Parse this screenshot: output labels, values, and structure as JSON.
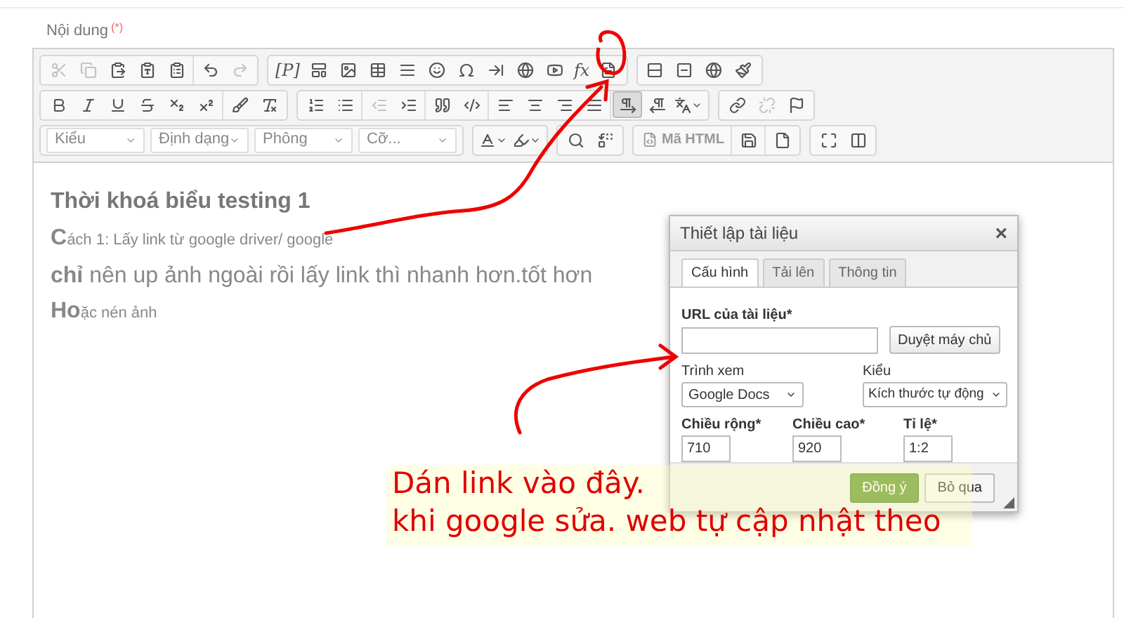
{
  "field": {
    "label": "Nội dung",
    "required_mark": "(*)"
  },
  "toolbar": {
    "rows": [
      {
        "groups": [
          [
            [
              {
                "kind": "icon",
                "disabled": true,
                "on": false
              },
              {
                "kind": "icon",
                "disabled": true,
                "on": false
              },
              {
                "kind": "icon",
                "disabled": false,
                "on": false
              },
              {
                "kind": "icon",
                "disabled": false,
                "on": false
              },
              {
                "kind": "icon",
                "disabled": false,
                "on": false
              }
            ],
            [
              {
                "kind": "icon",
                "disabled": false,
                "on": false
              },
              {
                "kind": "icon",
                "disabled": true,
                "on": false
              }
            ]
          ],
          [
            [
              {
                "kind": "label",
                "label": "[P]",
                "disabled": false,
                "on": false
              },
              {
                "kind": "icon",
                "disabled": false,
                "on": false
              },
              {
                "kind": "icon",
                "disabled": false,
                "on": false
              },
              {
                "kind": "icon",
                "disabled": false,
                "on": false
              },
              {
                "kind": "icon",
                "disabled": false,
                "on": false
              },
              {
                "kind": "icon",
                "disabled": false,
                "on": false
              },
              {
                "kind": "icon",
                "disabled": false,
                "on": false
              },
              {
                "kind": "icon",
                "disabled": false,
                "on": false
              },
              {
                "kind": "icon",
                "disabled": false,
                "on": false
              },
              {
                "kind": "icon",
                "disabled": false,
                "on": false
              },
              {
                "kind": "label",
                "label": "fx",
                "disabled": false,
                "on": false
              },
              {
                "kind": "icon",
                "disabled": false,
                "on": false
              }
            ]
          ],
          [
            [
              {
                "kind": "icon",
                "disabled": false,
                "on": false
              },
              {
                "kind": "icon",
                "disabled": false,
                "on": false
              },
              {
                "kind": "icon",
                "disabled": false,
                "on": false
              },
              {
                "kind": "icon",
                "disabled": false,
                "on": false
              }
            ]
          ]
        ]
      },
      {
        "groups": [
          [
            [
              {
                "kind": "icon",
                "disabled": false,
                "on": false
              },
              {
                "kind": "icon",
                "disabled": false,
                "on": false
              },
              {
                "kind": "icon",
                "disabled": false,
                "on": false
              },
              {
                "kind": "icon",
                "disabled": false,
                "on": false
              },
              {
                "kind": "icon",
                "disabled": false,
                "on": false
              },
              {
                "kind": "icon",
                "disabled": false,
                "on": false
              }
            ],
            [
              {
                "kind": "icon",
                "disabled": false,
                "on": false
              },
              {
                "kind": "icon",
                "disabled": false,
                "on": false
              }
            ]
          ],
          [
            [
              {
                "kind": "icon",
                "disabled": false,
                "on": false
              },
              {
                "kind": "icon",
                "disabled": false,
                "on": false
              }
            ],
            [
              {
                "kind": "icon",
                "disabled": true,
                "on": false
              },
              {
                "kind": "icon",
                "disabled": false,
                "on": false
              }
            ],
            [
              {
                "kind": "icon",
                "disabled": false,
                "on": false
              },
              {
                "kind": "icon",
                "disabled": false,
                "on": false
              }
            ],
            [
              {
                "kind": "icon",
                "disabled": false,
                "on": false
              },
              {
                "kind": "icon",
                "disabled": false,
                "on": false
              },
              {
                "kind": "icon",
                "disabled": false,
                "on": false
              },
              {
                "kind": "icon",
                "disabled": false,
                "on": false
              }
            ],
            [
              {
                "kind": "icon",
                "disabled": false,
                "on": true
              },
              {
                "kind": "icon",
                "disabled": false,
                "on": false
              },
              {
                "kind": "menu",
                "disabled": false,
                "on": false
              }
            ]
          ],
          [
            [
              {
                "kind": "icon",
                "disabled": false,
                "on": false
              },
              {
                "kind": "icon",
                "disabled": true,
                "on": false
              },
              {
                "kind": "icon",
                "disabled": false,
                "on": false
              }
            ]
          ]
        ]
      },
      {
        "groups": [
          [
            [
              {
                "kind": "dropdown",
                "label": "Kiểu"
              },
              {
                "kind": "dropdown",
                "label": "Định dạng"
              },
              {
                "kind": "dropdown",
                "label": "Phông"
              },
              {
                "kind": "dropdown",
                "label": "Cỡ..."
              }
            ]
          ],
          [
            [
              {
                "kind": "menu",
                "disabled": false,
                "on": false
              },
              {
                "kind": "menu",
                "disabled": false,
                "on": false
              }
            ]
          ],
          [
            [
              {
                "kind": "icon",
                "disabled": false,
                "on": false
              },
              {
                "kind": "icon",
                "disabled": false,
                "on": false
              }
            ]
          ],
          [
            [
              {
                "kind": "source",
                "label": "Mã HTML",
                "disabled": false,
                "on": false
              }
            ],
            [
              {
                "kind": "icon",
                "disabled": false,
                "on": false
              }
            ],
            [
              {
                "kind": "icon",
                "disabled": false,
                "on": false
              }
            ]
          ],
          [
            [
              {
                "kind": "icon",
                "disabled": false,
                "on": false
              },
              {
                "kind": "icon",
                "disabled": false,
                "on": false
              }
            ]
          ]
        ]
      }
    ]
  },
  "content": {
    "title": "Thời khoá biểu testing 1",
    "lines": [
      {
        "lead": "C",
        "text": "ách 1: Lấy link từ google driver/ google"
      },
      {
        "text": "**chỉ** nên up ảnh ngoài rồi lấy link thì nhanh hơn.tốt hơn"
      },
      {
        "lead": "Ho",
        "text": "ặc nén ảnh"
      }
    ]
  },
  "dialog": {
    "title": "Thiết lập tài liệu",
    "close": "×",
    "tabs": [
      {
        "label": "Cấu hình",
        "selected": true
      },
      {
        "label": "Tải lên",
        "selected": false
      },
      {
        "label": "Thông tin",
        "selected": false
      }
    ],
    "url": {
      "label": "URL của tài liệu*",
      "browse": "Duyệt máy chủ"
    },
    "viewer": {
      "label": "Trình xem",
      "value": "Google Docs"
    },
    "style": {
      "label": "Kiểu",
      "value": "Kích thước tự động"
    },
    "sizes": [
      {
        "label": "Chiều rộng*",
        "value": "710"
      },
      {
        "label": "Chiều cao*",
        "value": "920"
      },
      {
        "label": "Tỉ lệ*",
        "value": "1:2"
      }
    ],
    "ok": "Đồng ý",
    "cancel": "Bỏ qua"
  },
  "annotation": {
    "lines": [
      "Dán link vào đây.",
      "khi google sửa. web tự cập nhật theo"
    ]
  }
}
